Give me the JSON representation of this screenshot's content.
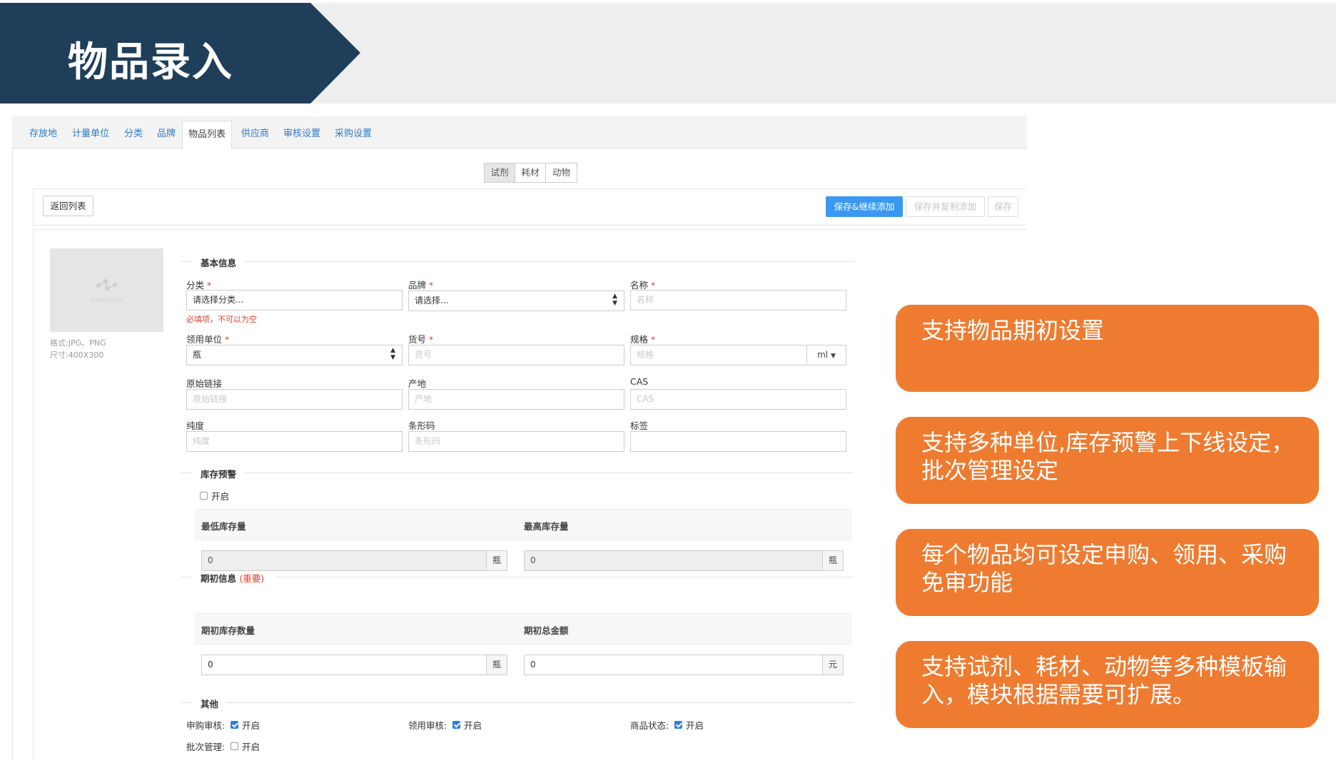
{
  "slide_title": "物品录入",
  "tabs": [
    "存放地",
    "计量单位",
    "分类",
    "品牌",
    "物品列表",
    "供应商",
    "审核设置",
    "采购设置"
  ],
  "active_tab": "物品列表",
  "type_buttons": [
    "试剂",
    "耗材",
    "动物"
  ],
  "active_type": "试剂",
  "toolbar": {
    "back": "返回列表",
    "save_continue": "保存&继续添加",
    "save_copy": "保存并复制添加",
    "save": "保存"
  },
  "image_hint": {
    "format": "格式:JPG、PNG",
    "size": "尺寸:400X300",
    "logo_text": "SmarterLab"
  },
  "basic": {
    "title": "基本信息",
    "category": {
      "label": "分类",
      "placeholder": "请选择分类...",
      "error": "必填项，不可以为空"
    },
    "brand": {
      "label": "品牌",
      "value": "请选择..."
    },
    "name": {
      "label": "名称",
      "placeholder": "名称"
    },
    "unit": {
      "label": "领用单位",
      "value": "瓶"
    },
    "sku": {
      "label": "货号",
      "placeholder": "货号"
    },
    "spec": {
      "label": "规格",
      "placeholder": "规格",
      "unit": "ml"
    },
    "source_link": {
      "label": "原始链接",
      "placeholder": "原始链接"
    },
    "origin": {
      "label": "产地",
      "placeholder": "产地"
    },
    "cas": {
      "label": "CAS",
      "placeholder": "CAS"
    },
    "purity": {
      "label": "纯度",
      "placeholder": "纯度"
    },
    "barcode": {
      "label": "条形码",
      "placeholder": "条形码"
    },
    "tags": {
      "label": "标签",
      "placeholder": ""
    }
  },
  "stock_alert": {
    "title": "库存预警",
    "enable_label": "开启",
    "enabled": false,
    "min_label": "最低库存量",
    "max_label": "最高库存量",
    "min_value": "0",
    "max_value": "0",
    "unit": "瓶"
  },
  "initial": {
    "title": "期初信息",
    "important": "(重要)",
    "qty_label": "期初库存数量",
    "amount_label": "期初总金额",
    "qty_value": "0",
    "amount_value": "0",
    "qty_unit": "瓶",
    "amount_unit": "元"
  },
  "other": {
    "title": "其他",
    "purchase_audit": {
      "label": "申购审核:",
      "opt": "开启",
      "checked": true
    },
    "use_audit": {
      "label": "领用审核:",
      "opt": "开启",
      "checked": true
    },
    "product_status": {
      "label": "商品状态:",
      "opt": "开启",
      "checked": true
    },
    "batch_mgmt": {
      "label": "批次管理:",
      "opt": "开启",
      "checked": false
    }
  },
  "callouts": [
    "支持物品期初设置",
    "支持多种单位,库存预警上下线设定，批次管理设定",
    "每个物品均可设定申购、领用、采购免审功能",
    "支持试剂、耗材、动物等多种模板输入，模块根据需要可扩展。"
  ],
  "colors": {
    "title_bg": "#1f3e5a",
    "callout_bg": "#ee7b30",
    "primary_btn": "#3a98f0",
    "link": "#2e7bc4",
    "required": "#e0412b"
  }
}
